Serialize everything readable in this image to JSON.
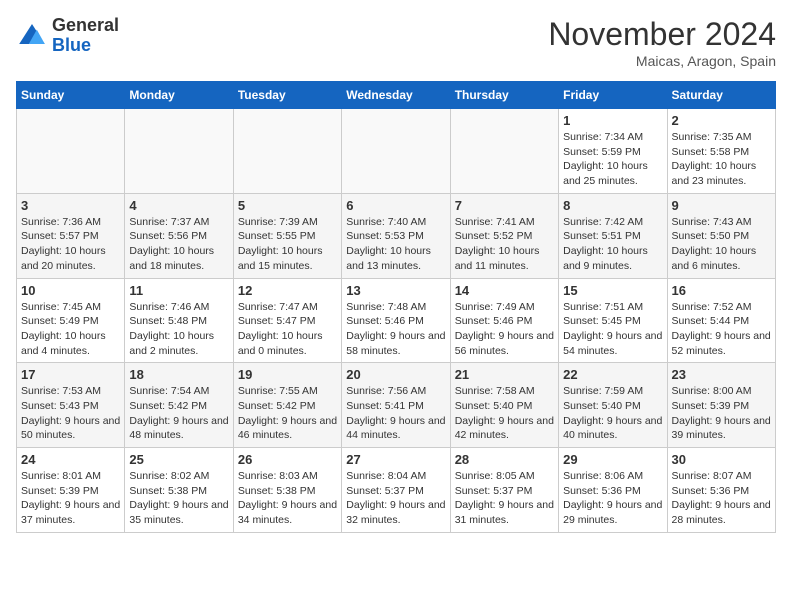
{
  "header": {
    "logo_general": "General",
    "logo_blue": "Blue",
    "month_year": "November 2024",
    "location": "Maicas, Aragon, Spain"
  },
  "days_of_week": [
    "Sunday",
    "Monday",
    "Tuesday",
    "Wednesday",
    "Thursday",
    "Friday",
    "Saturday"
  ],
  "weeks": [
    [
      {
        "day": "",
        "info": ""
      },
      {
        "day": "",
        "info": ""
      },
      {
        "day": "",
        "info": ""
      },
      {
        "day": "",
        "info": ""
      },
      {
        "day": "",
        "info": ""
      },
      {
        "day": "1",
        "info": "Sunrise: 7:34 AM\nSunset: 5:59 PM\nDaylight: 10 hours and 25 minutes."
      },
      {
        "day": "2",
        "info": "Sunrise: 7:35 AM\nSunset: 5:58 PM\nDaylight: 10 hours and 23 minutes."
      }
    ],
    [
      {
        "day": "3",
        "info": "Sunrise: 7:36 AM\nSunset: 5:57 PM\nDaylight: 10 hours and 20 minutes."
      },
      {
        "day": "4",
        "info": "Sunrise: 7:37 AM\nSunset: 5:56 PM\nDaylight: 10 hours and 18 minutes."
      },
      {
        "day": "5",
        "info": "Sunrise: 7:39 AM\nSunset: 5:55 PM\nDaylight: 10 hours and 15 minutes."
      },
      {
        "day": "6",
        "info": "Sunrise: 7:40 AM\nSunset: 5:53 PM\nDaylight: 10 hours and 13 minutes."
      },
      {
        "day": "7",
        "info": "Sunrise: 7:41 AM\nSunset: 5:52 PM\nDaylight: 10 hours and 11 minutes."
      },
      {
        "day": "8",
        "info": "Sunrise: 7:42 AM\nSunset: 5:51 PM\nDaylight: 10 hours and 9 minutes."
      },
      {
        "day": "9",
        "info": "Sunrise: 7:43 AM\nSunset: 5:50 PM\nDaylight: 10 hours and 6 minutes."
      }
    ],
    [
      {
        "day": "10",
        "info": "Sunrise: 7:45 AM\nSunset: 5:49 PM\nDaylight: 10 hours and 4 minutes."
      },
      {
        "day": "11",
        "info": "Sunrise: 7:46 AM\nSunset: 5:48 PM\nDaylight: 10 hours and 2 minutes."
      },
      {
        "day": "12",
        "info": "Sunrise: 7:47 AM\nSunset: 5:47 PM\nDaylight: 10 hours and 0 minutes."
      },
      {
        "day": "13",
        "info": "Sunrise: 7:48 AM\nSunset: 5:46 PM\nDaylight: 9 hours and 58 minutes."
      },
      {
        "day": "14",
        "info": "Sunrise: 7:49 AM\nSunset: 5:46 PM\nDaylight: 9 hours and 56 minutes."
      },
      {
        "day": "15",
        "info": "Sunrise: 7:51 AM\nSunset: 5:45 PM\nDaylight: 9 hours and 54 minutes."
      },
      {
        "day": "16",
        "info": "Sunrise: 7:52 AM\nSunset: 5:44 PM\nDaylight: 9 hours and 52 minutes."
      }
    ],
    [
      {
        "day": "17",
        "info": "Sunrise: 7:53 AM\nSunset: 5:43 PM\nDaylight: 9 hours and 50 minutes."
      },
      {
        "day": "18",
        "info": "Sunrise: 7:54 AM\nSunset: 5:42 PM\nDaylight: 9 hours and 48 minutes."
      },
      {
        "day": "19",
        "info": "Sunrise: 7:55 AM\nSunset: 5:42 PM\nDaylight: 9 hours and 46 minutes."
      },
      {
        "day": "20",
        "info": "Sunrise: 7:56 AM\nSunset: 5:41 PM\nDaylight: 9 hours and 44 minutes."
      },
      {
        "day": "21",
        "info": "Sunrise: 7:58 AM\nSunset: 5:40 PM\nDaylight: 9 hours and 42 minutes."
      },
      {
        "day": "22",
        "info": "Sunrise: 7:59 AM\nSunset: 5:40 PM\nDaylight: 9 hours and 40 minutes."
      },
      {
        "day": "23",
        "info": "Sunrise: 8:00 AM\nSunset: 5:39 PM\nDaylight: 9 hours and 39 minutes."
      }
    ],
    [
      {
        "day": "24",
        "info": "Sunrise: 8:01 AM\nSunset: 5:39 PM\nDaylight: 9 hours and 37 minutes."
      },
      {
        "day": "25",
        "info": "Sunrise: 8:02 AM\nSunset: 5:38 PM\nDaylight: 9 hours and 35 minutes."
      },
      {
        "day": "26",
        "info": "Sunrise: 8:03 AM\nSunset: 5:38 PM\nDaylight: 9 hours and 34 minutes."
      },
      {
        "day": "27",
        "info": "Sunrise: 8:04 AM\nSunset: 5:37 PM\nDaylight: 9 hours and 32 minutes."
      },
      {
        "day": "28",
        "info": "Sunrise: 8:05 AM\nSunset: 5:37 PM\nDaylight: 9 hours and 31 minutes."
      },
      {
        "day": "29",
        "info": "Sunrise: 8:06 AM\nSunset: 5:36 PM\nDaylight: 9 hours and 29 minutes."
      },
      {
        "day": "30",
        "info": "Sunrise: 8:07 AM\nSunset: 5:36 PM\nDaylight: 9 hours and 28 minutes."
      }
    ]
  ]
}
